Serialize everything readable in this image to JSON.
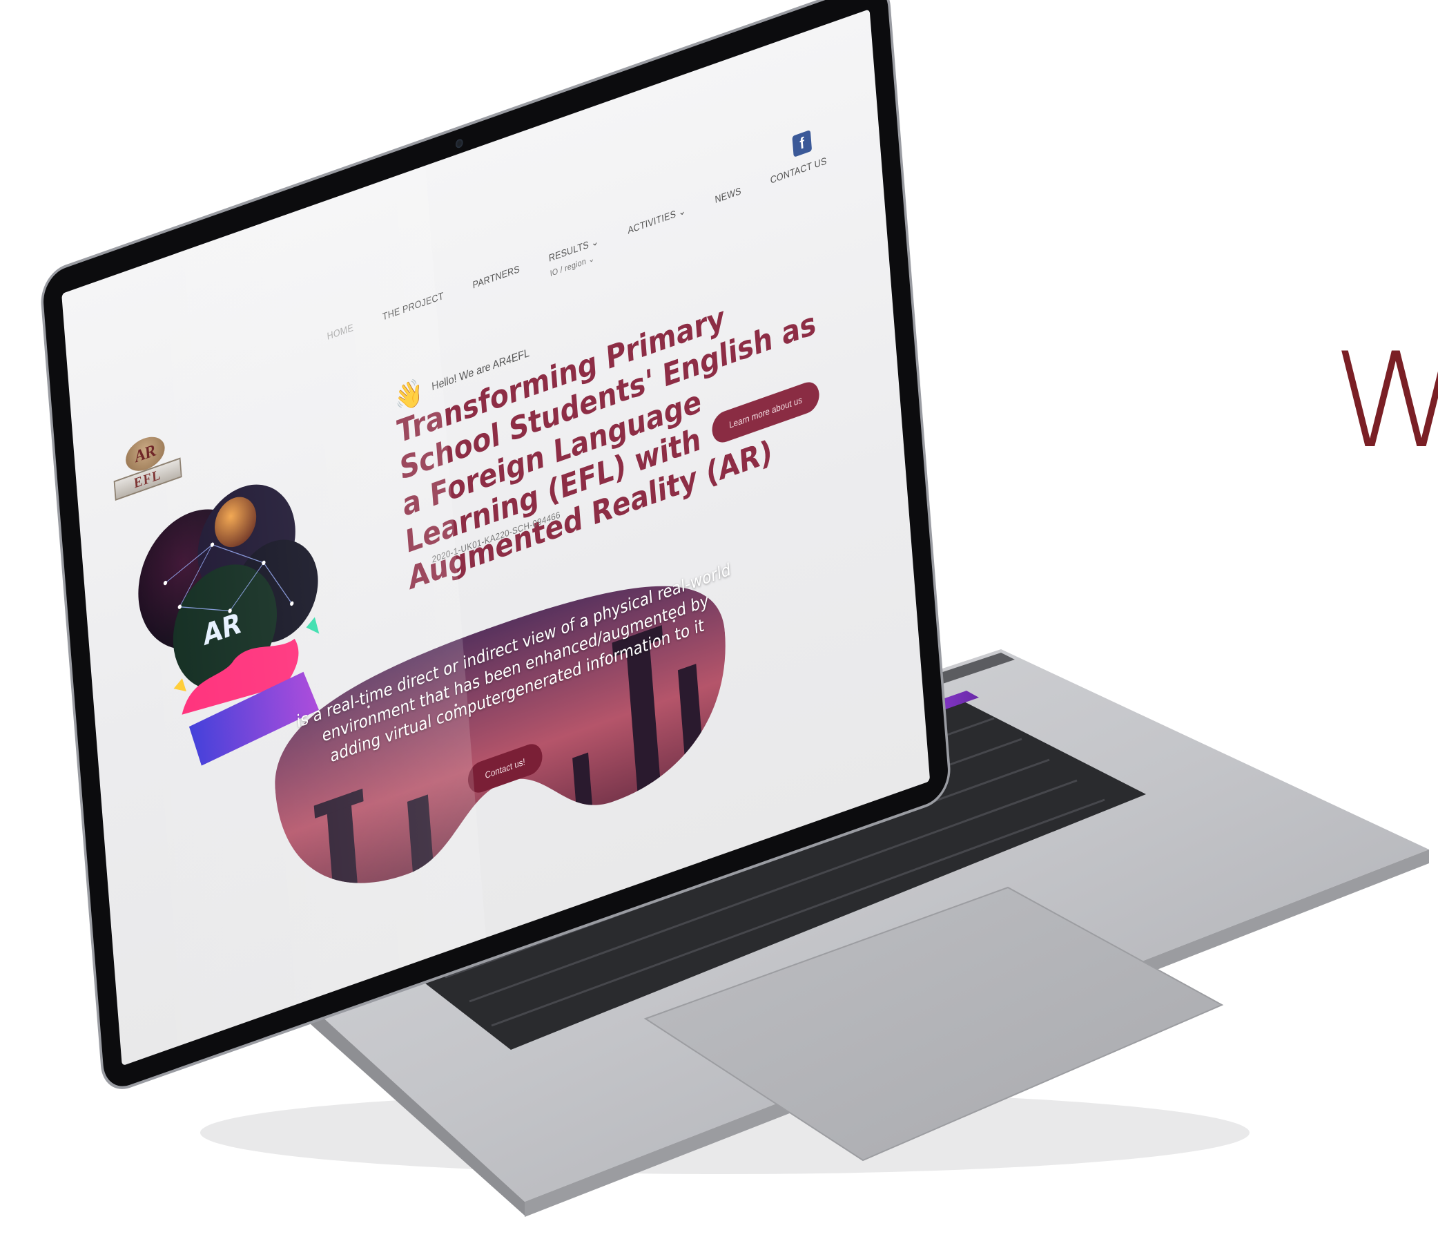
{
  "nav": {
    "items": [
      {
        "label": "HOME"
      },
      {
        "label": "THE PROJECT"
      },
      {
        "label": "PARTNERS"
      },
      {
        "label": "RESULTS ⌄",
        "sub": "IO / region ⌄"
      },
      {
        "label": "ACTIVITIES ⌄"
      },
      {
        "label": "NEWS"
      },
      {
        "label": "CONTACT US"
      }
    ],
    "facebook_glyph": "f"
  },
  "logo": {
    "top": "AR",
    "bottom": "EFL"
  },
  "illustration": {
    "ar_text": "AR"
  },
  "hero": {
    "greeting": "Hello! We are AR4EFL",
    "wave_glyph": "👋",
    "headline": "Transforming Primary School Students' English as a Foreign Language Learning (EFL) with Augmented Reality (AR)",
    "cta_label": "Learn more about us",
    "project_code": "2020-1-UK01-KA220-SCH-094466"
  },
  "banner": {
    "text": "is a real-time direct or indirect view of a physical real-world environment that has been enhanced/augmented by adding virtual computergenerated information to it",
    "contact_label": "Contact us!"
  },
  "side_text": {
    "partial_word": "W"
  },
  "colors": {
    "brand": "#8d2d45",
    "button": "#8a2c43",
    "side_word": "#7a1f25"
  },
  "icons": [
    "facebook-icon",
    "wave-hand-icon",
    "chevron-down-icon"
  ]
}
